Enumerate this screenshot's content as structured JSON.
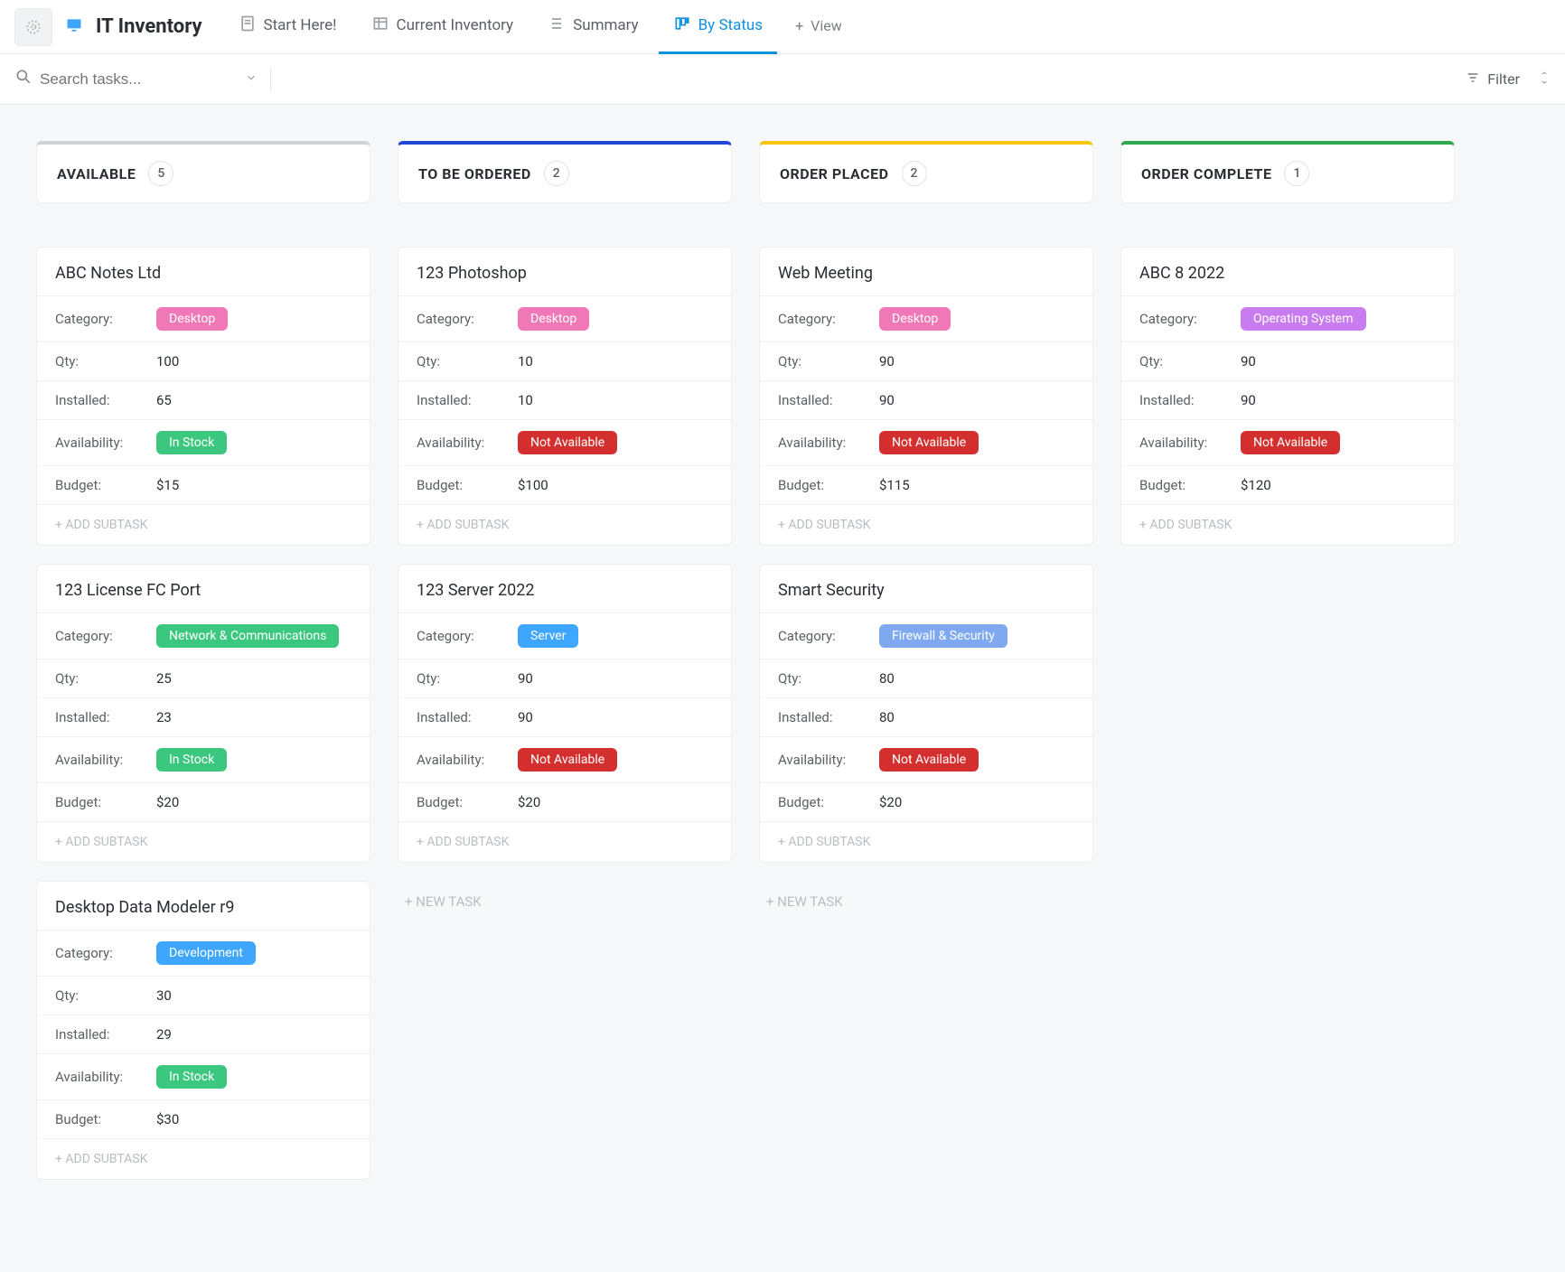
{
  "header": {
    "app_title": "IT Inventory",
    "tabs": [
      {
        "label": "Start Here!"
      },
      {
        "label": "Current Inventory"
      },
      {
        "label": "Summary"
      },
      {
        "label": "By Status"
      },
      {
        "label": "View"
      }
    ]
  },
  "search": {
    "placeholder": "Search tasks...",
    "filter_label": "Filter"
  },
  "labels": {
    "category": "Category:",
    "qty": "Qty:",
    "installed": "Installed:",
    "availability": "Availability:",
    "budget": "Budget:",
    "add_subtask": "+ ADD SUBTASK",
    "new_task": "+ NEW TASK"
  },
  "pills": {
    "desktop": "Desktop",
    "os": "Operating System",
    "network": "Network & Communications",
    "server": "Server",
    "firewall": "Firewall & Security",
    "development": "Development",
    "in_stock": "In Stock",
    "not_available": "Not Available"
  },
  "columns": [
    {
      "title": "AVAILABLE",
      "count": "5",
      "accent": "#cfd3d8",
      "cards": [
        {
          "title": "ABC Notes Ltd",
          "category": "desktop",
          "qty": "100",
          "installed": "65",
          "availability": "in_stock",
          "budget": "$15"
        },
        {
          "title": "123 License FC Port",
          "category": "network",
          "qty": "25",
          "installed": "23",
          "availability": "in_stock",
          "budget": "$20"
        },
        {
          "title": "Desktop Data Modeler r9",
          "category": "development",
          "qty": "30",
          "installed": "29",
          "availability": "in_stock",
          "budget": "$30"
        }
      ],
      "show_new_task": false
    },
    {
      "title": "TO BE ORDERED",
      "count": "2",
      "accent": "#2447d6",
      "cards": [
        {
          "title": "123 Photoshop",
          "category": "desktop",
          "qty": "10",
          "installed": "10",
          "availability": "not_available",
          "budget": "$100"
        },
        {
          "title": "123 Server 2022",
          "category": "server",
          "qty": "90",
          "installed": "90",
          "availability": "not_available",
          "budget": "$20"
        }
      ],
      "show_new_task": true
    },
    {
      "title": "ORDER PLACED",
      "count": "2",
      "accent": "#f5c518",
      "cards": [
        {
          "title": "Web Meeting",
          "category": "desktop",
          "qty": "90",
          "installed": "90",
          "availability": "not_available",
          "budget": "$115"
        },
        {
          "title": "Smart Security",
          "category": "firewall",
          "qty": "80",
          "installed": "80",
          "availability": "not_available",
          "budget": "$20"
        }
      ],
      "show_new_task": true
    },
    {
      "title": "ORDER COMPLETE",
      "count": "1",
      "accent": "#2fa84f",
      "cards": [
        {
          "title": "ABC 8 2022",
          "category": "os",
          "qty": "90",
          "installed": "90",
          "availability": "not_available",
          "budget": "$120"
        }
      ],
      "show_new_task": false
    }
  ]
}
